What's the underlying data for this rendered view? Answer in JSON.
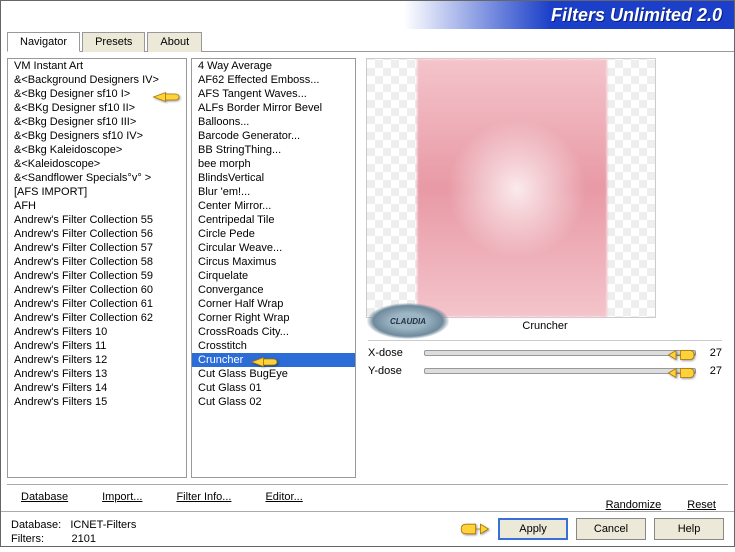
{
  "app_title": "Filters Unlimited 2.0",
  "tabs": [
    {
      "label": "Navigator",
      "active": true
    },
    {
      "label": "Presets",
      "active": false
    },
    {
      "label": "About",
      "active": false
    }
  ],
  "categories": [
    "VM Instant Art",
    "&<Background Designers IV>",
    "&<Bkg Designer sf10 I>",
    "&<BKg Designer sf10 II>",
    "&<Bkg Designer sf10 III>",
    "&<Bkg Designers sf10 IV>",
    "&<Bkg Kaleidoscope>",
    "&<Kaleidoscope>",
    "&<Sandflower Specials°v° >",
    "[AFS IMPORT]",
    "AFH",
    "Andrew's Filter Collection 55",
    "Andrew's Filter Collection 56",
    "Andrew's Filter Collection 57",
    "Andrew's Filter Collection 58",
    "Andrew's Filter Collection 59",
    "Andrew's Filter Collection 60",
    "Andrew's Filter Collection 61",
    "Andrew's Filter Collection 62",
    "Andrew's Filters 10",
    "Andrew's Filters 11",
    "Andrew's Filters 12",
    "Andrew's Filters 13",
    "Andrew's Filters 14",
    "Andrew's Filters 15"
  ],
  "filters": [
    "4 Way Average",
    "AF62 Effected Emboss...",
    "AFS Tangent Waves...",
    "ALFs Border Mirror Bevel",
    "Balloons...",
    "Barcode Generator...",
    "BB StringThing...",
    "bee morph",
    "BlindsVertical",
    "Blur 'em!...",
    "Center Mirror...",
    "Centripedal Tile",
    "Circle Pede",
    "Circular Weave...",
    "Circus Maximus",
    "Cirquelate",
    "Convergance",
    "Corner Half Wrap",
    "Corner Right Wrap",
    "CrossRoads City...",
    "Crosstitch",
    "Cruncher",
    "Cut Glass  BugEye",
    "Cut Glass 01",
    "Cut Glass 02"
  ],
  "selected_filter_index": 21,
  "current_filter_name": "Cruncher",
  "params": [
    {
      "label": "X-dose",
      "value": "27"
    },
    {
      "label": "Y-dose",
      "value": "27"
    }
  ],
  "nav_buttons": {
    "database": "Database",
    "import": "Import...",
    "filter_info": "Filter Info...",
    "editor": "Editor..."
  },
  "right_buttons": {
    "randomize": "Randomize",
    "reset": "Reset"
  },
  "footer": {
    "db_label": "Database:",
    "db_value": "ICNET-Filters",
    "filters_label": "Filters:",
    "filters_value": "2101",
    "apply": "Apply",
    "cancel": "Cancel",
    "help": "Help"
  },
  "watermark": "CLAUDIA"
}
